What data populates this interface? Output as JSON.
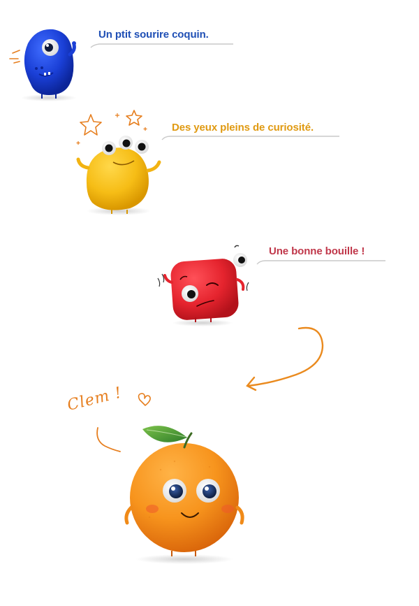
{
  "captions": [
    {
      "text": "Un ptit sourire coquin.",
      "color": "#1f4fb5"
    },
    {
      "text": "Des yeux pleins de curiosité.",
      "color": "#e09a12"
    },
    {
      "text": "Une bonne bouille !",
      "color": "#c0374a"
    }
  ],
  "handwritten": {
    "text": "Clem !",
    "color": "#e67e1e"
  },
  "characters": [
    {
      "name": "blue-monster",
      "color": "#1a3fd6"
    },
    {
      "name": "yellow-monster",
      "color": "#f6bd16"
    },
    {
      "name": "red-monster",
      "color": "#e5242e"
    },
    {
      "name": "orange-character",
      "color": "#f7941d"
    }
  ],
  "icons": [
    "heart-icon",
    "star-icon",
    "arrow-icon",
    "leaf-icon"
  ]
}
